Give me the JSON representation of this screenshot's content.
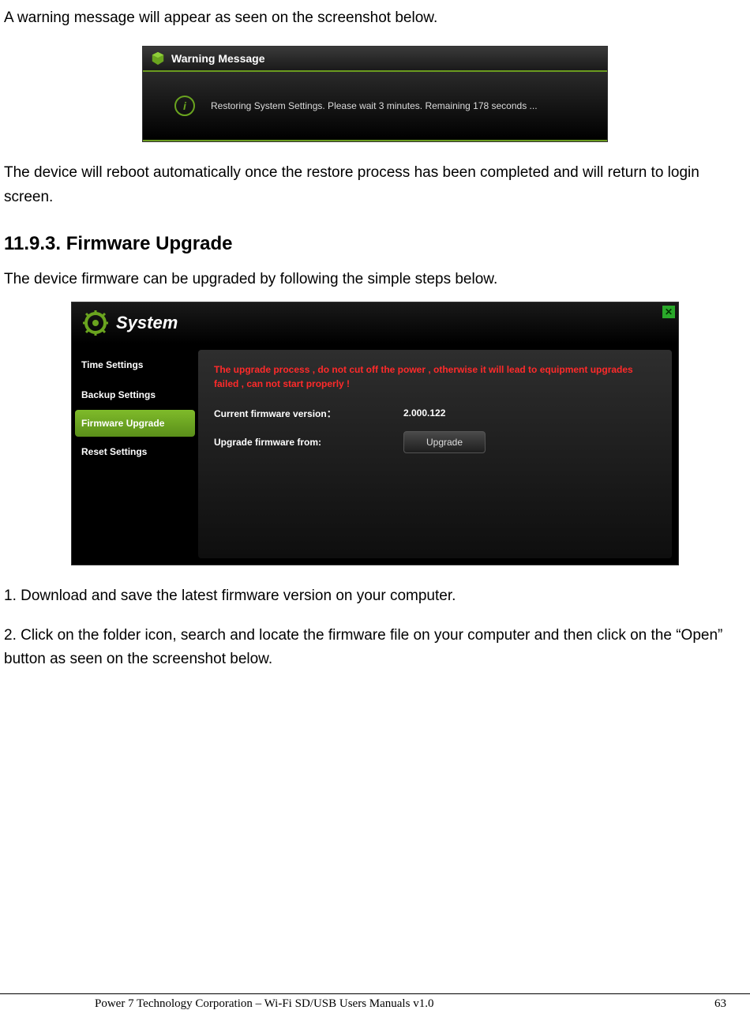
{
  "intro_text": "A warning message will appear as seen on the screenshot below.",
  "warning_dialog": {
    "title": "Warning Message",
    "body": "Restoring System Settings. Please wait 3 minutes. Remaining 178 seconds ..."
  },
  "after_warning_text": "The device will reboot automatically once the restore process has been completed and will return to login screen.",
  "section_heading": "11.9.3. Firmware Upgrade",
  "firmware_intro": "The device firmware can be upgraded by following the simple steps below.",
  "system_dialog": {
    "title": "System",
    "sidebar": [
      {
        "label": "Time Settings",
        "active": false
      },
      {
        "label": "Backup Settings",
        "active": false
      },
      {
        "label": "Firmware Upgrade",
        "active": true
      },
      {
        "label": "Reset Settings",
        "active": false
      }
    ],
    "warning_red": "The upgrade process , do not cut off the power , otherwise it will lead to equipment upgrades failed , can not start properly !",
    "row1_label": "Current firmware version：",
    "row1_value": "2.000.122",
    "row2_label": "Upgrade firmware from:",
    "upgrade_button": "Upgrade"
  },
  "step1": "1. Download and save the latest firmware version on your computer.",
  "step2": "2. Click on the folder icon, search and locate the firmware file on your computer and then click on the “Open” button as seen on the screenshot below.",
  "footer": {
    "left": "Power 7 Technology Corporation – Wi-Fi SD/USB Users Manuals v1.0",
    "right": "63"
  }
}
